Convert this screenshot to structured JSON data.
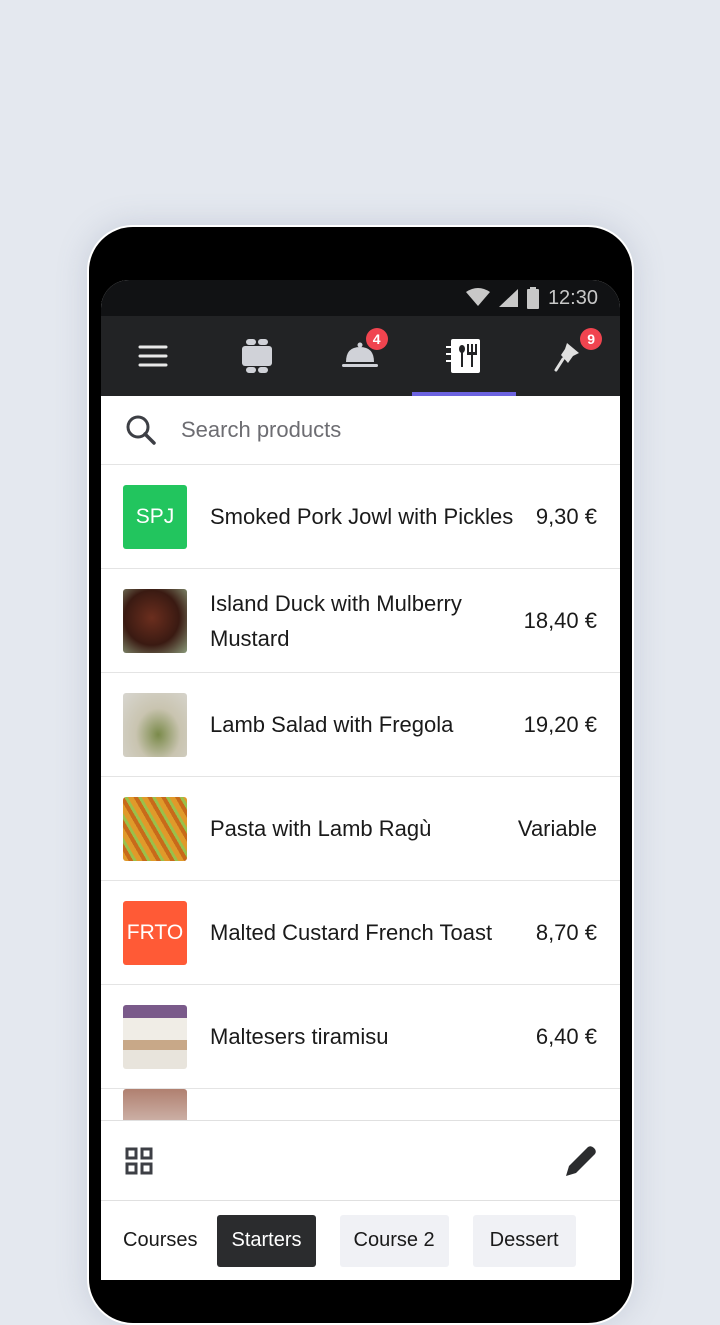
{
  "status": {
    "time": "12:30"
  },
  "nav": {
    "tabs": [
      {
        "icon": "menu-icon"
      },
      {
        "icon": "table-icon"
      },
      {
        "icon": "cloche-icon",
        "badge": "4"
      },
      {
        "icon": "menu-book-icon",
        "active": true
      },
      {
        "icon": "pin-icon",
        "badge": "9"
      }
    ],
    "accent": "#6c63e0"
  },
  "search": {
    "placeholder": "Search products"
  },
  "products": [
    {
      "name": "Smoked Pork Jowl with Pickles",
      "price": "9,30 €",
      "initials": "SPJ",
      "color": "#22c55e"
    },
    {
      "name": "Island Duck with Mulberry Mustard",
      "price": "18,40 €",
      "image": "duck"
    },
    {
      "name": "Lamb Salad with Fregola",
      "price": "19,20 €",
      "image": "salad"
    },
    {
      "name": "Pasta with Lamb Ragù",
      "price": "Variable",
      "image": "pasta"
    },
    {
      "name": "Malted Custard French Toast",
      "price": "8,70 €",
      "initials": "FRTO",
      "color": "#ff5a36"
    },
    {
      "name": "Maltesers tiramisu",
      "price": "6,40 €",
      "image": "tiramisu"
    }
  ],
  "courses": {
    "label": "Courses",
    "items": [
      "Starters",
      "Course 2",
      "Dessert"
    ],
    "selected": "Starters"
  }
}
